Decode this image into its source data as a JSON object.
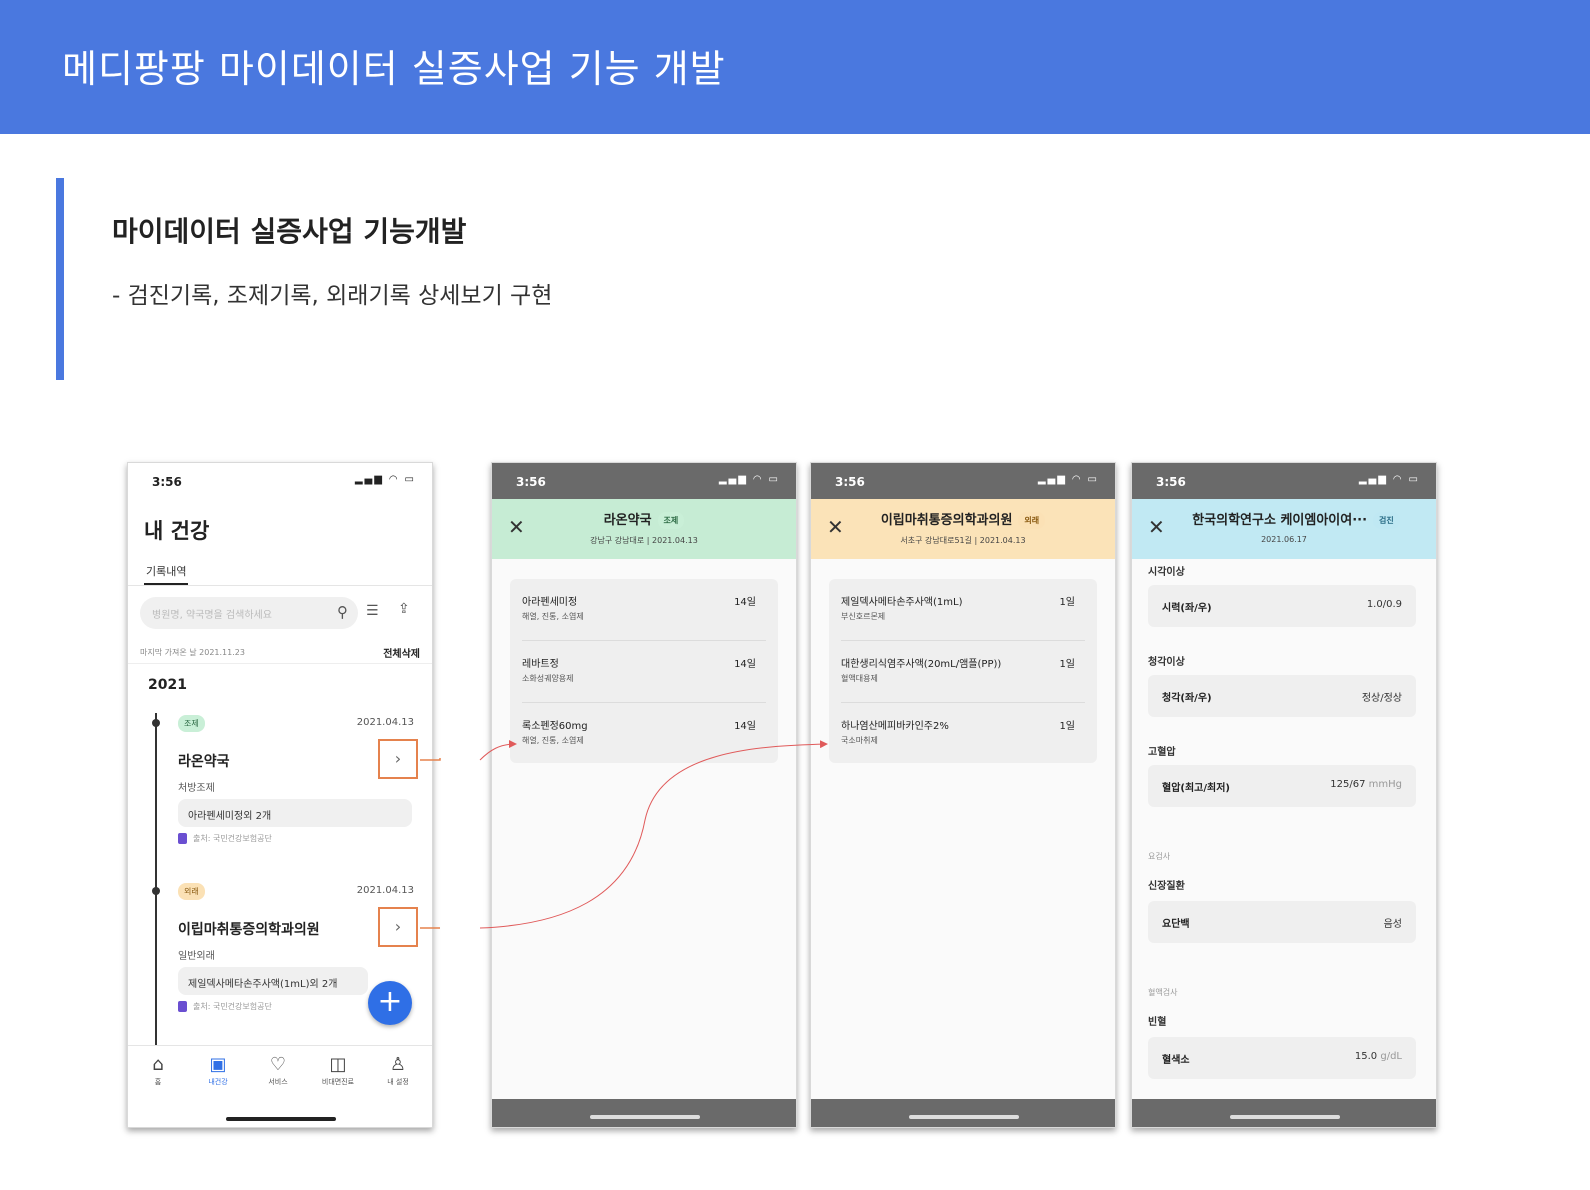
{
  "banner": {
    "title": "메디팡팡 마이데이터 실증사업 기능 개발"
  },
  "section": {
    "title": "마이데이터 실증사업 기능개발",
    "desc": "- 검진기록, 조제기록, 외래기록 상세보기 구현"
  },
  "phone1": {
    "time": "3:56",
    "title": "내 건강",
    "tab": "기록내역",
    "search_placeholder": "병원명, 약국명을 검색하세요",
    "sync_text": "마지막 가져온 날 2021.11.23",
    "delete_all": "전체삭제",
    "year": "2021",
    "records": [
      {
        "badge": "조제",
        "date": "2021.04.13",
        "title": "라온약국",
        "sub": "처방조제",
        "box": "아라펜세미정외 2개",
        "source": "출처: 국민건강보험공단"
      },
      {
        "badge": "외래",
        "date": "2021.04.13",
        "title": "이립마취통증의학과의원",
        "sub": "일반외래",
        "box": "제일덱사메타손주사액(1mL)외 2개",
        "source": "출처: 국민건강보험공단"
      }
    ],
    "nav": [
      {
        "label": "홈",
        "icon": "home-icon"
      },
      {
        "label": "내건강",
        "icon": "health-icon"
      },
      {
        "label": "서비스",
        "icon": "heart-icon"
      },
      {
        "label": "비대면진료",
        "icon": "telemedicine-icon"
      },
      {
        "label": "내 설정",
        "icon": "person-icon"
      }
    ]
  },
  "phone2": {
    "time": "3:56",
    "title": "라온약국",
    "badge": "조제",
    "sub": "강남구 강남대로 | 2021.04.13",
    "meds": [
      {
        "name": "아라펜세미정",
        "desc": "해열, 진통, 소염제",
        "qty": "14일"
      },
      {
        "name": "레바트정",
        "desc": "소화성궤양용제",
        "qty": "14일"
      },
      {
        "name": "록소펜정60mg",
        "desc": "해열, 진통, 소염제",
        "qty": "14일"
      }
    ]
  },
  "phone3": {
    "time": "3:56",
    "title": "이립마취통증의학과의원",
    "badge": "외래",
    "sub": "서초구 강남대로51길 | 2021.04.13",
    "meds": [
      {
        "name": "제일덱사메타손주사액(1mL)",
        "desc": "부신호르몬제",
        "qty": "1일"
      },
      {
        "name": "대한생리식염주사액(20mL/앰플(PP))",
        "desc": "혈액대용제",
        "qty": "1일"
      },
      {
        "name": "하나염산메피바카인주2%",
        "desc": "국소마취제",
        "qty": "1일"
      }
    ]
  },
  "phone4": {
    "time": "3:56",
    "title": "한국의학연구소 케이엠아이여···",
    "badge": "검진",
    "sub": "2021.06.17",
    "groups": [
      {
        "label": "시각이상",
        "key": "시력(좌/우)",
        "value": "1.0/0.9",
        "unit": ""
      },
      {
        "label": "청각이상",
        "key": "청각(좌/우)",
        "value": "정상/정상",
        "unit": ""
      },
      {
        "label": "고혈압",
        "key": "혈압(최고/최저)",
        "value": "125/67",
        "unit": "mmHg"
      },
      {
        "small": "요검사",
        "label": "신장질환",
        "key": "요단백",
        "value": "음성",
        "unit": ""
      },
      {
        "small": "혈액검사",
        "label": "빈혈",
        "key": "혈색소",
        "value": "15.0",
        "unit": "g/dL"
      }
    ]
  },
  "colors": {
    "accent": "#4a78df",
    "highlight": "#e5824d",
    "connector": "#e05a5a"
  }
}
